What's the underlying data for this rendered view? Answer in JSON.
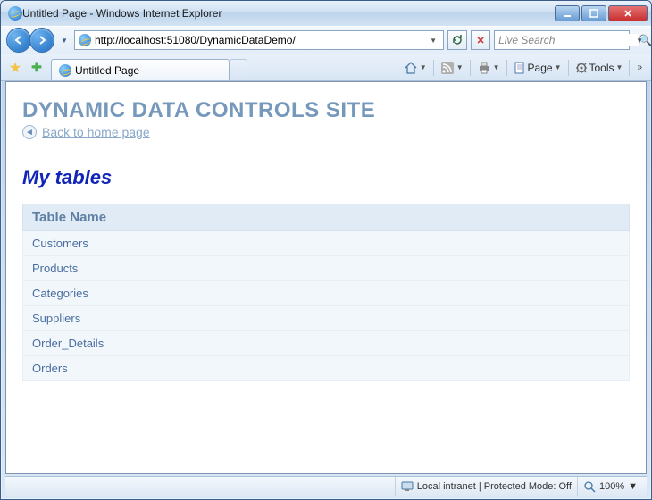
{
  "window": {
    "title": "Untitled Page - Windows Internet Explorer"
  },
  "address": {
    "url": "http://localhost:51080/DynamicDataDemo/"
  },
  "search": {
    "placeholder": "Live Search"
  },
  "tab": {
    "title": "Untitled Page"
  },
  "commandbar": {
    "page_label": "Page",
    "tools_label": "Tools"
  },
  "content": {
    "site_title": "DYNAMIC DATA CONTROLS SITE",
    "back_label": "Back to home page",
    "section_heading": "My tables",
    "table": {
      "header": "Table Name",
      "rows": [
        "Customers",
        "Products",
        "Categories",
        "Suppliers",
        "Order_Details",
        "Orders"
      ]
    }
  },
  "status": {
    "zone": "Local intranet | Protected Mode: Off",
    "zoom": "100%"
  }
}
